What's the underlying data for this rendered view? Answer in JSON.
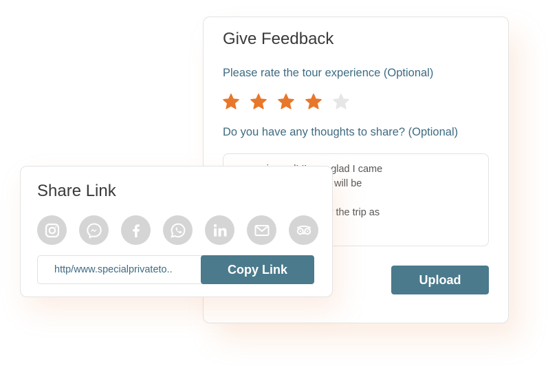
{
  "feedback": {
    "title": "Give Feedback",
    "rate_question": "Please rate the tour experience (Optional)",
    "rating": 4,
    "rating_max": 5,
    "thoughts_question": "Do you have any thoughts to share? (Optional)",
    "thoughts_text": "…xperienced! I’m so glad I came\n…rs to all of you, and will be\n…oon.\n…ude more meals for the trip as\n…rough the day.",
    "upload_label": "Upload"
  },
  "share": {
    "title": "Share Link",
    "icons": [
      "instagram-icon",
      "messenger-icon",
      "facebook-icon",
      "whatsapp-icon",
      "linkedin-icon",
      "email-icon",
      "tripadvisor-icon"
    ],
    "link_value": "http/www.specialprivateto..",
    "copy_label": "Copy Link"
  },
  "colors": {
    "accent": "#4a7a8c",
    "question_text": "#3e6b82",
    "star_filled": "#e8772a",
    "star_empty": "#e6e6e6",
    "icon_bg": "#d5d5d5"
  }
}
